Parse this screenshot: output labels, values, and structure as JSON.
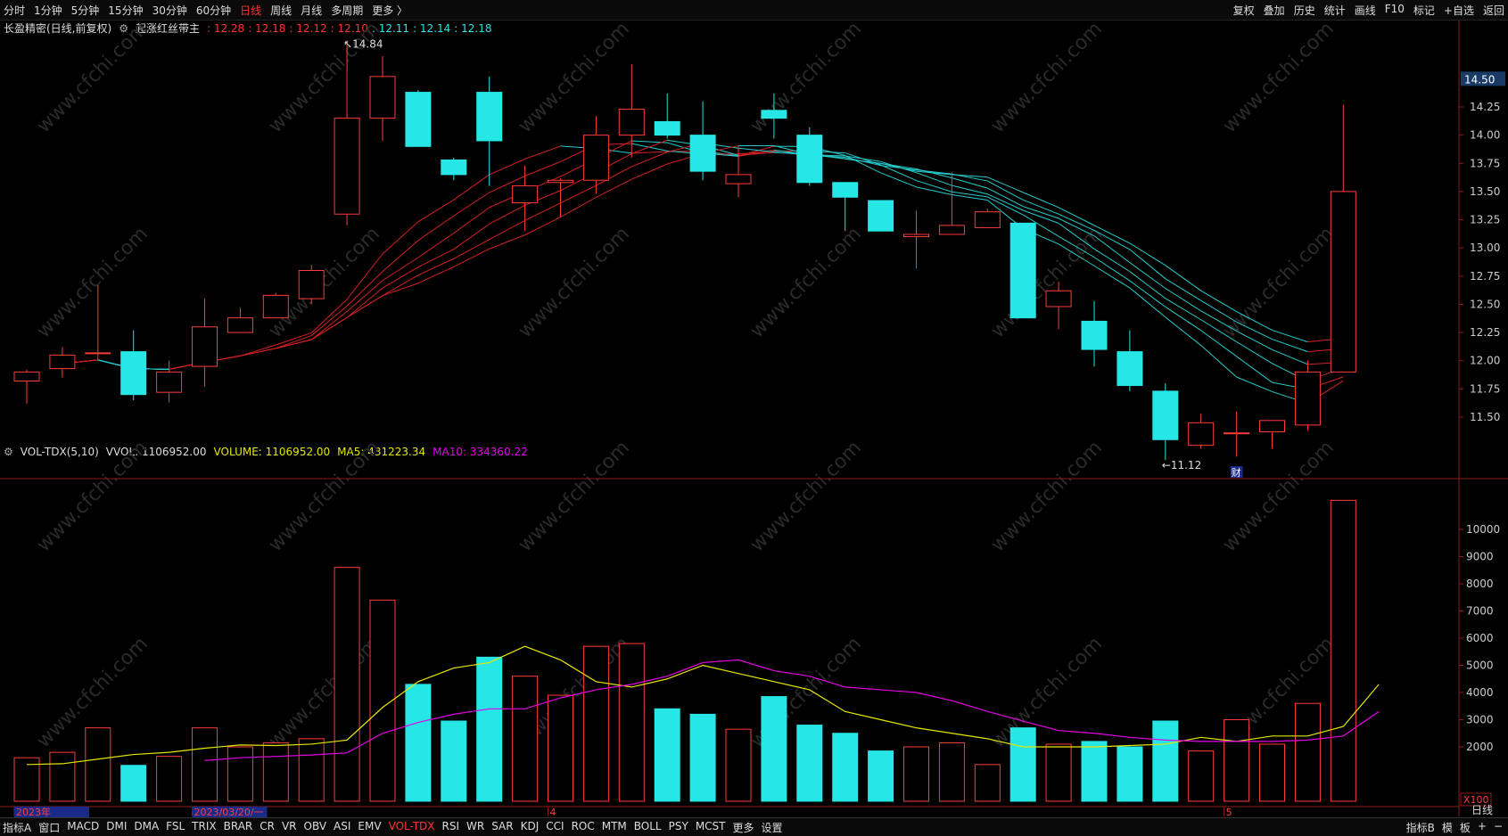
{
  "toolbar": {
    "tabs": [
      "分时",
      "1分钟",
      "5分钟",
      "15分钟",
      "30分钟",
      "60分钟",
      "日线",
      "周线",
      "月线",
      "多周期",
      "更多 〉"
    ],
    "active_tab": "日线",
    "tools": [
      "复权",
      "叠加",
      "历史",
      "统计",
      "画线",
      "F10",
      "标记",
      "+自选",
      "返回"
    ]
  },
  "main_legend": {
    "stock": "长盈精密(日线,前复权)",
    "indicator": "起涨红丝带主",
    "values": [
      {
        "text": "12.28",
        "color": "#ff3333"
      },
      {
        "text": "12.18",
        "color": "#ff3333"
      },
      {
        "text": "12.12",
        "color": "#ff3333"
      },
      {
        "text": "12.10",
        "color": "#ff3333"
      },
      {
        "text": "12.11",
        "color": "#26e6e6"
      },
      {
        "text": "12.14",
        "color": "#26e6e6"
      },
      {
        "text": "12.18",
        "color": "#26e6e6"
      }
    ]
  },
  "vol_legend": {
    "name": "VOL-TDX(5,10)",
    "vvol": "VVOL: 1106952.00",
    "volume": "VOLUME: 1106952.00",
    "ma5": "MA5: 431223.34",
    "ma10": "MA10: 334360.22"
  },
  "price_axis": {
    "current": "14.50",
    "ticks": [
      "14.25",
      "14.00",
      "13.75",
      "13.50",
      "13.25",
      "13.00",
      "12.75",
      "12.50",
      "12.25",
      "12.00",
      "11.75",
      "11.50"
    ]
  },
  "vol_axis": {
    "ticks": [
      "10000",
      "9000",
      "8000",
      "7000",
      "6000",
      "5000",
      "4000",
      "3000",
      "2000"
    ],
    "unit": "X100"
  },
  "annotations": {
    "high": "14.84",
    "low": "11.12",
    "finance_marker": "财"
  },
  "x_labels": [
    {
      "index": 0,
      "text": "2023年"
    },
    {
      "index": 5,
      "text": "2023/03/20/一"
    },
    {
      "index": 15,
      "text": "4"
    },
    {
      "index": 34,
      "text": "5"
    }
  ],
  "right_panel_label": "日线",
  "bottom": {
    "indicators": [
      "指标A",
      "窗口",
      "MACD",
      "DMI",
      "DMA",
      "FSL",
      "TRIX",
      "BRAR",
      "CR",
      "VR",
      "OBV",
      "ASI",
      "EMV",
      "VOL-TDX",
      "RSI",
      "WR",
      "SAR",
      "KDJ",
      "CCI",
      "ROC",
      "MTM",
      "BOLL",
      "PSY",
      "MCST",
      "更多",
      "设置"
    ],
    "active_indicator": "VOL-TDX",
    "right": [
      "指标B",
      "模",
      "板",
      "+",
      "−"
    ]
  },
  "watermark": "www.cfchi.com",
  "chart_data": {
    "type": "candlestick",
    "price_range": [
      11.1,
      14.85
    ],
    "volume_range": [
      0,
      11100
    ],
    "candles": [
      {
        "o": 11.82,
        "h": 11.92,
        "l": 11.62,
        "c": 11.9,
        "v": 1600
      },
      {
        "o": 11.93,
        "h": 12.12,
        "l": 11.85,
        "c": 12.05,
        "v": 1800
      },
      {
        "o": 12.07,
        "h": 12.67,
        "l": 12.0,
        "c": 12.07,
        "v": 2700
      },
      {
        "o": 12.08,
        "h": 12.27,
        "l": 11.65,
        "c": 11.7,
        "v": 1320
      },
      {
        "o": 11.72,
        "h": 12.0,
        "l": 11.63,
        "c": 11.9,
        "v": 1650
      },
      {
        "o": 11.95,
        "h": 12.55,
        "l": 11.77,
        "c": 12.3,
        "v": 2700
      },
      {
        "o": 12.25,
        "h": 12.47,
        "l": 12.25,
        "c": 12.38,
        "v": 2000
      },
      {
        "o": 12.38,
        "h": 12.6,
        "l": 12.38,
        "c": 12.58,
        "v": 2150
      },
      {
        "o": 12.55,
        "h": 12.85,
        "l": 12.5,
        "c": 12.8,
        "v": 2300
      },
      {
        "o": 13.3,
        "h": 14.84,
        "l": 13.2,
        "c": 14.15,
        "v": 8600
      },
      {
        "o": 14.15,
        "h": 14.7,
        "l": 13.95,
        "c": 14.52,
        "v": 7400
      },
      {
        "o": 14.38,
        "h": 14.4,
        "l": 13.9,
        "c": 13.9,
        "v": 4300
      },
      {
        "o": 13.78,
        "h": 13.8,
        "l": 13.6,
        "c": 13.65,
        "v": 2950
      },
      {
        "o": 14.38,
        "h": 14.52,
        "l": 13.55,
        "c": 13.95,
        "v": 5300
      },
      {
        "o": 13.4,
        "h": 13.73,
        "l": 13.15,
        "c": 13.55,
        "v": 4600
      },
      {
        "o": 13.58,
        "h": 13.62,
        "l": 13.27,
        "c": 13.6,
        "v": 3900
      },
      {
        "o": 13.6,
        "h": 14.17,
        "l": 13.48,
        "c": 14.0,
        "v": 5700
      },
      {
        "o": 14.0,
        "h": 14.63,
        "l": 13.8,
        "c": 14.23,
        "v": 5800
      },
      {
        "o": 14.12,
        "h": 14.37,
        "l": 13.97,
        "c": 14.0,
        "v": 3400
      },
      {
        "o": 14.0,
        "h": 14.3,
        "l": 13.6,
        "c": 13.68,
        "v": 3200
      },
      {
        "o": 13.57,
        "h": 13.9,
        "l": 13.45,
        "c": 13.65,
        "v": 2650
      },
      {
        "o": 14.22,
        "h": 14.37,
        "l": 13.97,
        "c": 14.15,
        "v": 3850
      },
      {
        "o": 14.0,
        "h": 14.07,
        "l": 13.55,
        "c": 13.58,
        "v": 2800
      },
      {
        "o": 13.58,
        "h": 13.58,
        "l": 13.15,
        "c": 13.45,
        "v": 2500
      },
      {
        "o": 13.42,
        "h": 13.42,
        "l": 13.15,
        "c": 13.15,
        "v": 1850
      },
      {
        "o": 13.1,
        "h": 13.33,
        "l": 12.82,
        "c": 13.12,
        "v": 2000
      },
      {
        "o": 13.12,
        "h": 13.67,
        "l": 13.12,
        "c": 13.2,
        "v": 2150
      },
      {
        "o": 13.18,
        "h": 13.35,
        "l": 13.18,
        "c": 13.32,
        "v": 1350
      },
      {
        "o": 13.22,
        "h": 13.22,
        "l": 12.38,
        "c": 12.38,
        "v": 2700
      },
      {
        "o": 12.48,
        "h": 12.7,
        "l": 12.28,
        "c": 12.62,
        "v": 2100
      },
      {
        "o": 12.35,
        "h": 12.53,
        "l": 11.95,
        "c": 12.1,
        "v": 2200
      },
      {
        "o": 12.08,
        "h": 12.27,
        "l": 11.73,
        "c": 11.78,
        "v": 2000
      },
      {
        "o": 11.73,
        "h": 11.8,
        "l": 11.12,
        "c": 11.3,
        "v": 2950
      },
      {
        "o": 11.25,
        "h": 11.53,
        "l": 11.22,
        "c": 11.45,
        "v": 1850
      },
      {
        "o": 11.36,
        "h": 11.55,
        "l": 11.15,
        "c": 11.36,
        "v": 3000
      },
      {
        "o": 11.37,
        "h": 11.47,
        "l": 11.22,
        "c": 11.47,
        "v": 2100
      },
      {
        "o": 11.43,
        "h": 12.0,
        "l": 11.38,
        "c": 11.9,
        "v": 3600
      },
      {
        "o": 11.9,
        "h": 14.27,
        "l": 11.9,
        "c": 13.5,
        "v": 11070
      }
    ],
    "vol_ma5": [
      1350,
      1380,
      1550,
      1720,
      1800,
      1950,
      2070,
      2050,
      2100,
      2250,
      3450,
      4400,
      4900,
      5100,
      5700,
      5200,
      4400,
      4200,
      4500,
      5000,
      4700,
      4400,
      4100,
      3300,
      3000,
      2700,
      2500,
      2300,
      2000,
      2000,
      2000,
      2050,
      2100,
      2350,
      2200,
      2400,
      2400,
      2750,
      4300
    ],
    "vol_ma10": [
      null,
      null,
      null,
      null,
      null,
      1500,
      1600,
      1650,
      1700,
      1780,
      2500,
      2900,
      3200,
      3400,
      3400,
      3800,
      4100,
      4300,
      4600,
      5100,
      5200,
      4800,
      4600,
      4200,
      4100,
      4000,
      3700,
      3300,
      2950,
      2600,
      2500,
      2350,
      2250,
      2200,
      2200,
      2200,
      2250,
      2400,
      3300
    ]
  }
}
